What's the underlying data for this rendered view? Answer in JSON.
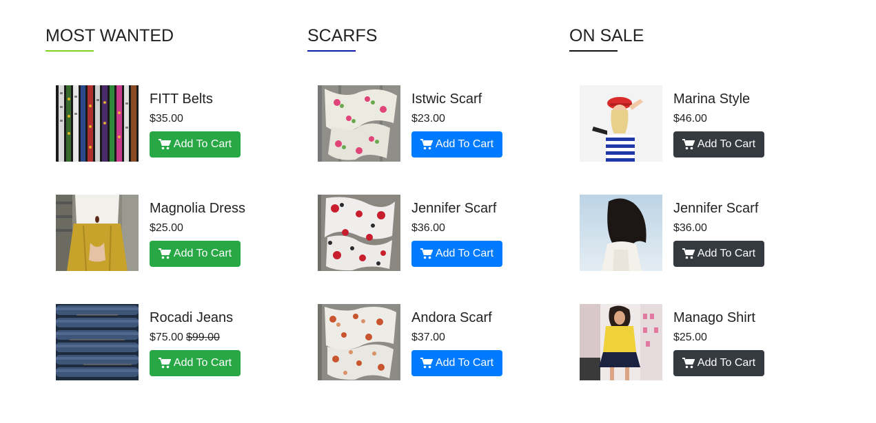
{
  "columns": [
    {
      "title": "MOST WANTED",
      "accent": "#7ed321",
      "products": [
        {
          "name": "FITT Belts",
          "price": "$35.00",
          "old_price": "",
          "button": "Add To Cart",
          "image": "belts"
        },
        {
          "name": "Magnolia Dress",
          "price": "$25.00",
          "old_price": "",
          "button": "Add To Cart",
          "image": "dress"
        },
        {
          "name": "Rocadi Jeans",
          "price": "$75.00",
          "old_price": "$99.00",
          "button": "Add To Cart",
          "image": "jeans"
        }
      ]
    },
    {
      "title": "SCARFS",
      "accent": "#0b1aa8",
      "products": [
        {
          "name": "Istwic Scarf",
          "price": "$23.00",
          "old_price": "",
          "button": "Add To Cart",
          "image": "scarf-pink"
        },
        {
          "name": "Jennifer Scarf",
          "price": "$36.00",
          "old_price": "",
          "button": "Add To Cart",
          "image": "scarf-red"
        },
        {
          "name": "Andora Scarf",
          "price": "$37.00",
          "old_price": "",
          "button": "Add To Cart",
          "image": "scarf-orange"
        }
      ]
    },
    {
      "title": "ON SALE",
      "accent": "#111111",
      "products": [
        {
          "name": "Marina Style",
          "price": "$46.00",
          "old_price": "",
          "button": "Add To Cart",
          "image": "woman-red-cap"
        },
        {
          "name": "Jennifer Scarf",
          "price": "$36.00",
          "old_price": "",
          "button": "Add To Cart",
          "image": "woman-dark-hair"
        },
        {
          "name": "Manago Shirt",
          "price": "$25.00",
          "old_price": "",
          "button": "Add To Cart",
          "image": "woman-yellow-shirt"
        }
      ]
    }
  ],
  "button_colors": {
    "most_wanted": "#28a745",
    "scarfs": "#007bff",
    "on_sale": "#343a40"
  },
  "icons": {
    "cart": "shopping-cart-icon"
  }
}
